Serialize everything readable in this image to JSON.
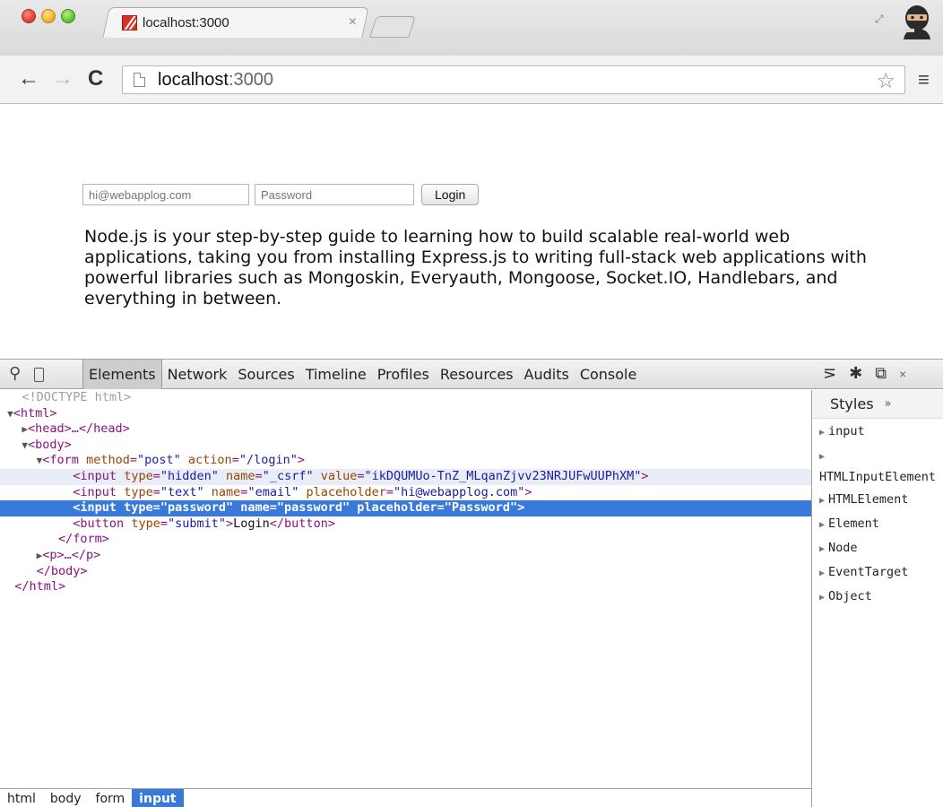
{
  "browser": {
    "tab_title": "localhost:3000",
    "tab_close": "×",
    "url_host": "localhost",
    "url_port": ":3000",
    "icons": {
      "back": "back-arrow-icon",
      "forward": "forward-arrow-icon",
      "reload": "reload-icon",
      "page": "page-icon",
      "star": "bookmark-star-icon",
      "menu": "hamburger-menu-icon"
    }
  },
  "page": {
    "email_placeholder": "hi@webapplog.com",
    "password_placeholder": "Password",
    "login_label": "Login",
    "intro": "Node.js is your step-by-step guide to learning how to build scalable real-world web applications, taking you from installing Express.js to writing full-stack web applications with powerful libraries such as Mongoskin, Everyauth, Mongoose, Socket.IO, Handlebars, and everything in between."
  },
  "devtools": {
    "tabs": [
      "Elements",
      "Network",
      "Sources",
      "Timeline",
      "Profiles",
      "Resources",
      "Audits",
      "Console"
    ],
    "active_tab": "Elements",
    "dom": {
      "doctype": "<!DOCTYPE html>",
      "html_open": "<html>",
      "head": "<head>…</head>",
      "body_open": "<body>",
      "form_tag": "form",
      "form_method_name": "method",
      "form_method_val": "\"post\"",
      "form_action_name": "action",
      "form_action_val": "\"/login\"",
      "csrf_type_val": "\"hidden\"",
      "csrf_name_val": "\"_csrf\"",
      "csrf_value_val": "\"ikDQUMUo-TnZ_MLqanZjvv23NRJUFwUUPhXM\"",
      "email_type_val": "\"text\"",
      "email_name_val": "\"email\"",
      "email_placeholder_val": "\"hi@webapplog.com\"",
      "pw_line": "<input type=\"password\" name=\"password\" placeholder=\"Password\">",
      "button_type_val": "\"submit\"",
      "button_text": "Login",
      "form_close": "</form>",
      "p_collapsed": "<p>…</p>",
      "body_close": "</body>",
      "html_close": "</html>"
    },
    "breadcrumbs": [
      "html",
      "body",
      "form",
      "input"
    ],
    "active_crumb": "input",
    "styles_label": "Styles",
    "styles_chevron": "»",
    "prototypes": [
      "input",
      "HTMLInputElement",
      "HTMLElement",
      "Element",
      "Node",
      "EventTarget",
      "Object"
    ]
  }
}
